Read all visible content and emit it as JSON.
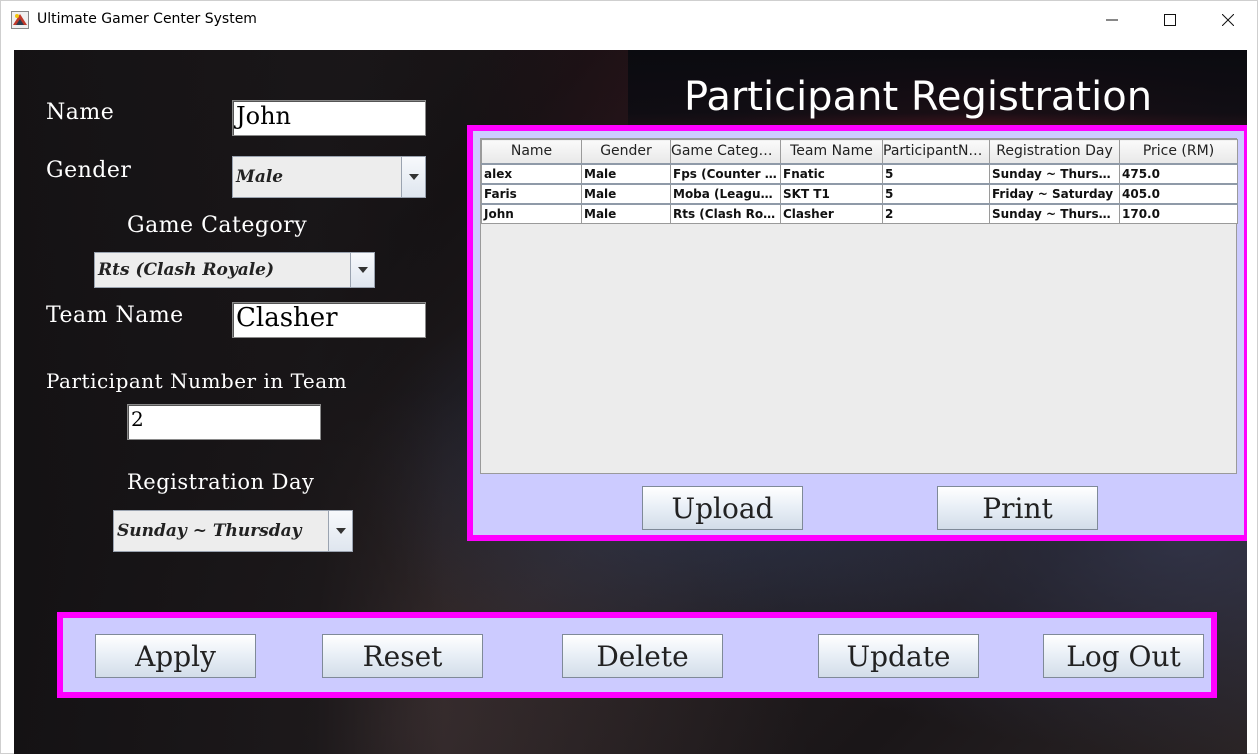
{
  "window": {
    "title": "Ultimate Gamer Center System"
  },
  "heading": "Participant Registration",
  "form": {
    "name_label": "Name",
    "name_value": "John",
    "gender_label": "Gender",
    "gender_value": "Male",
    "game_category_label": "Game Category",
    "game_category_value": "Rts (Clash Royale)",
    "team_name_label": "Team Name",
    "team_name_value": "Clasher",
    "participant_number_label": "Participant Number in Team",
    "participant_number_value": "2",
    "registration_day_label": "Registration Day",
    "registration_day_value": "Sunday ~ Thursday"
  },
  "table": {
    "columns": [
      "Name",
      "Gender",
      "Game Category",
      "Team Name",
      "ParticipantNum",
      "Registration Day",
      "Price (RM)"
    ],
    "rows": [
      [
        "alex",
        "Male",
        "Fps (Counter S...",
        "Fnatic",
        "5",
        "Sunday ~ Thursd...",
        "475.0"
      ],
      [
        "Faris",
        "Male",
        "Moba (League ...",
        "SKT T1",
        "5",
        "Friday ~ Saturday",
        "405.0"
      ],
      [
        "John",
        "Male",
        "Rts (Clash Roy...",
        "Clasher",
        "2",
        "Sunday ~ Thursd...",
        "170.0"
      ]
    ]
  },
  "table_buttons": {
    "upload": "Upload",
    "print": "Print"
  },
  "actions": {
    "apply": "Apply",
    "reset": "Reset",
    "delete": "Delete",
    "update": "Update",
    "logout": "Log Out"
  },
  "colors": {
    "frame_border": "#ff00ff",
    "frame_fill": "#cccbff"
  }
}
